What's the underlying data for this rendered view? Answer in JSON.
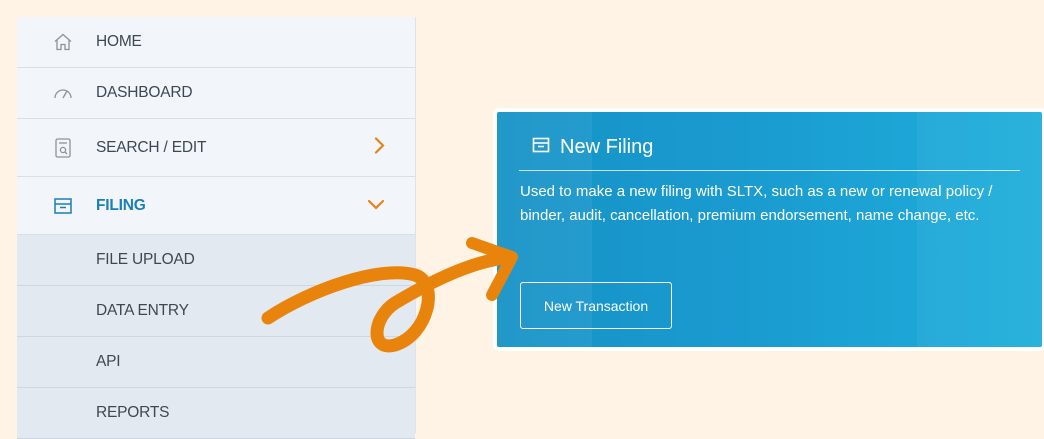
{
  "sidebar": {
    "items": [
      {
        "label": "HOME",
        "icon": "home-icon"
      },
      {
        "label": "DASHBOARD",
        "icon": "gauge-icon"
      },
      {
        "label": "SEARCH / EDIT",
        "icon": "search-document-icon",
        "chevron": "chevron-right-icon"
      },
      {
        "label": "FILING",
        "icon": "archive-box-icon",
        "chevron": "chevron-down-icon",
        "active": true
      }
    ],
    "subitems": [
      {
        "label": "FILE UPLOAD"
      },
      {
        "label": "DATA ENTRY"
      },
      {
        "label": "API"
      },
      {
        "label": "REPORTS"
      }
    ]
  },
  "card": {
    "title": "New Filing",
    "icon": "archive-box-icon",
    "description": "Used to make a new filing with SLTX, such as a new or renewal policy / binder, audit, cancellation, premium endorsement, name change, etc.",
    "button_label": "New Transaction"
  },
  "colors": {
    "background": "#fef3e4",
    "accent": "#1a7fb5",
    "chevron": "#e8811a",
    "arrow": "#e8840c",
    "card_gradient_start": "#1592c6",
    "card_gradient_end": "#1eaedb"
  }
}
